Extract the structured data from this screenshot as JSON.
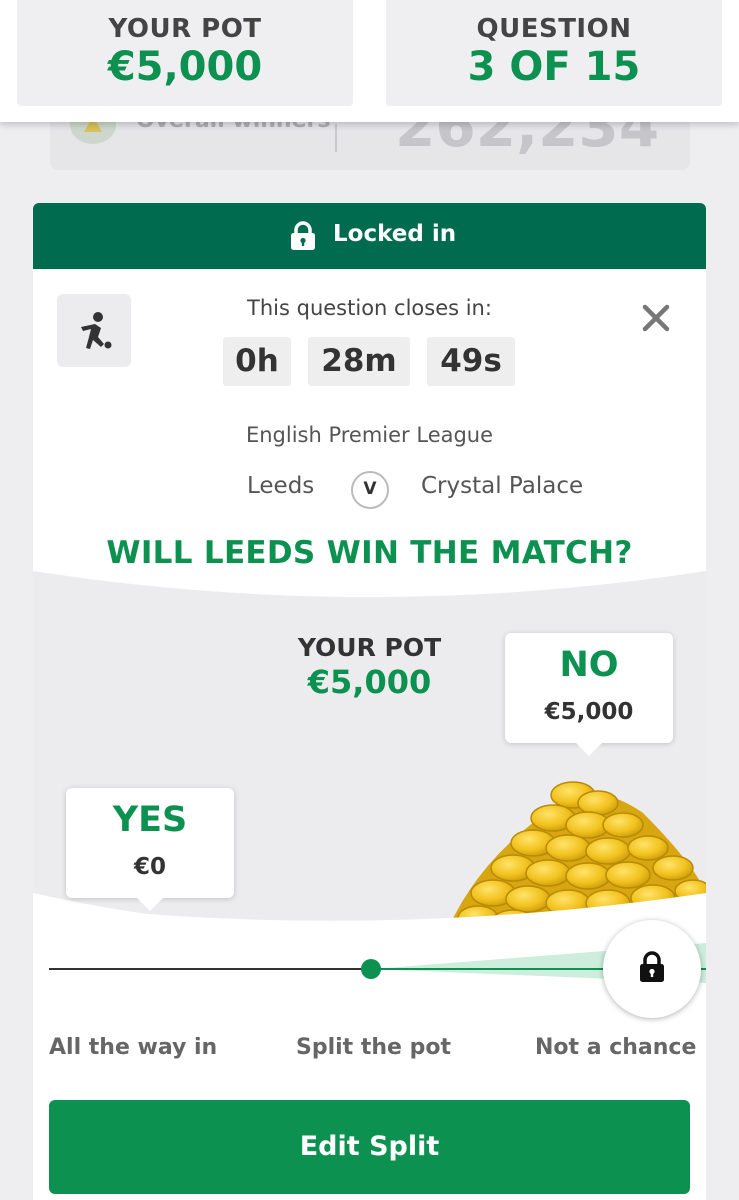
{
  "stats": {
    "pot_label": "YOUR POT",
    "pot_value": "€5,000",
    "question_label": "QUESTION",
    "question_value": "3 OF 15"
  },
  "winners": {
    "label": "Overall winners",
    "count": "262,234"
  },
  "card": {
    "locked_label": "Locked in",
    "closes_label": "This question closes in:",
    "timer": {
      "hours": "0h",
      "minutes": "28m",
      "seconds": "49s"
    },
    "league": "English Premier League",
    "home_team": "Leeds",
    "vs": "V",
    "away_team": "Crystal Palace",
    "question": "WILL LEEDS WIN THE MATCH?"
  },
  "pot": {
    "label": "YOUR POT",
    "value": "€5,000"
  },
  "options": {
    "no_label": "NO",
    "no_value": "€5,000",
    "yes_label": "YES",
    "yes_value": "€0"
  },
  "slider": {
    "labels": [
      "All the way in",
      "Split the pot",
      "Not a chance"
    ],
    "position": 1.0
  },
  "actions": {
    "edit_label": "Edit Split"
  },
  "colors": {
    "brand_green": "#0c9150",
    "dark_green": "#006b4f",
    "coin_gold": "#f2c21e"
  },
  "icons": {
    "sport": "football-player-icon",
    "close": "close-icon",
    "lock": "lock-icon",
    "trophy": "trophy-icon"
  }
}
